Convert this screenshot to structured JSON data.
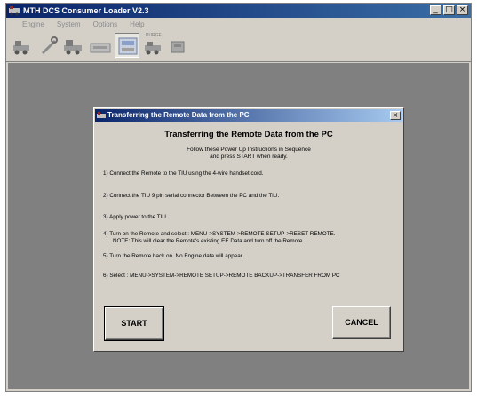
{
  "window": {
    "title": "MTH DCS Consumer Loader V2.3",
    "controls": {
      "minimize": "_",
      "maximize": "□",
      "close": "×"
    }
  },
  "menu": [
    "Engine",
    "System",
    "Options",
    "Help"
  ],
  "toolbar": {
    "buttons": [
      {
        "name": "engine-tool-icon",
        "caption": ""
      },
      {
        "name": "wrench-tool-icon",
        "caption": ""
      },
      {
        "name": "tiu-tool-icon",
        "caption": ""
      },
      {
        "name": "remote-tool-icon",
        "caption": ""
      },
      {
        "name": "purge-tool-icon",
        "caption": "PURGE"
      },
      {
        "name": "settings-tool-icon",
        "caption": ""
      }
    ]
  },
  "dialog": {
    "title": "Transferring the Remote Data from the PC",
    "close": "×",
    "heading": "Transferring the Remote Data from the PC",
    "intro_line1": "Follow these Power Up Instructions in Sequence",
    "intro_line2": "and press START when ready.",
    "steps": {
      "s1": "1)  Connect the Remote to the TIU using the 4-wire handset cord.",
      "s2": "2)  Connect the TIU 9 pin serial connector Between the PC and the TIU.",
      "s3": "3)  Apply power to the TIU.",
      "s4a": "4)  Turn on the Remote and  select : MENU->SYSTEM->REMOTE SETUP->RESET REMOTE.",
      "s4b": "NOTE: This will clear the Remote's existing EE Data and turn off the Remote.",
      "s5": "5)  Turn the Remote back on.  No Engine data will appear.",
      "s6": "6)  Select : MENU->SYSTEM->REMOTE SETUP->REMOTE BACKUP->TRANSFER FROM PC"
    },
    "start_label": "START",
    "cancel_label": "CANCEL"
  }
}
